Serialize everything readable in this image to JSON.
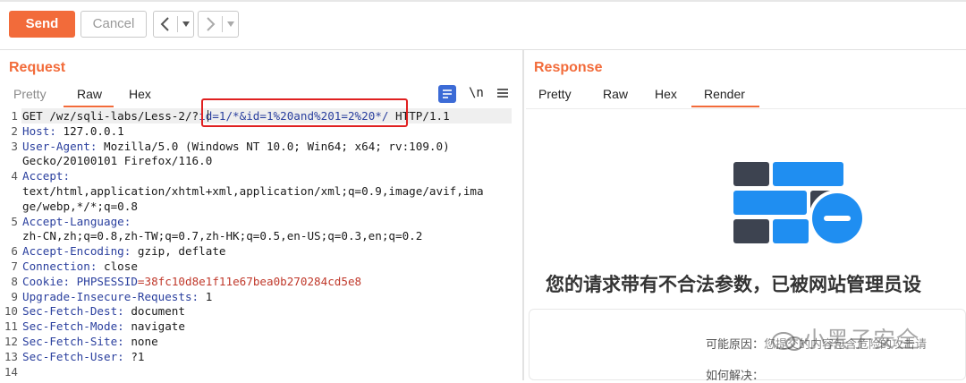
{
  "toolbar": {
    "send_label": "Send",
    "cancel_label": "Cancel",
    "back_icon": "chevron-left-icon",
    "forward_icon": "chevron-right-icon"
  },
  "request": {
    "title": "Request",
    "tabs": [
      "Pretty",
      "Raw",
      "Hex"
    ],
    "active_tab": "Raw",
    "toolbar_icons": [
      "message-format-icon",
      "newline-toggle-icon",
      "menu-icon"
    ],
    "newline_label": "\\n",
    "lines": [
      {
        "n": "1",
        "parts": [
          {
            "t": "GET /wz/sqli-labs/Less-2/?",
            "c": "plain"
          },
          {
            "t": "id=1/*&id=1%20and%201=2%20*/",
            "c": "param"
          },
          {
            "t": " HTTP/1.1",
            "c": "plain"
          }
        ]
      },
      {
        "n": "2",
        "parts": [
          {
            "t": "Host:",
            "c": "key"
          },
          {
            "t": " 127.0.0.1",
            "c": "plain"
          }
        ]
      },
      {
        "n": "3",
        "parts": [
          {
            "t": "User-Agent:",
            "c": "key"
          },
          {
            "t": " Mozilla/5.0 (Windows NT 10.0; Win64; x64; rv:109.0)",
            "c": "plain"
          }
        ]
      },
      {
        "n": "",
        "parts": [
          {
            "t": "Gecko/20100101 Firefox/116.0",
            "c": "plain"
          }
        ]
      },
      {
        "n": "4",
        "parts": [
          {
            "t": "Accept:",
            "c": "key"
          }
        ]
      },
      {
        "n": "",
        "parts": [
          {
            "t": "text/html,application/xhtml+xml,application/xml;q=0.9,image/avif,ima",
            "c": "plain"
          }
        ]
      },
      {
        "n": "",
        "parts": [
          {
            "t": "ge/webp,*/*;q=0.8",
            "c": "plain"
          }
        ]
      },
      {
        "n": "5",
        "parts": [
          {
            "t": "Accept-Language:",
            "c": "key"
          }
        ]
      },
      {
        "n": "",
        "parts": [
          {
            "t": "zh-CN,zh;q=0.8,zh-TW;q=0.7,zh-HK;q=0.5,en-US;q=0.3,en;q=0.2",
            "c": "plain"
          }
        ]
      },
      {
        "n": "6",
        "parts": [
          {
            "t": "Accept-Encoding:",
            "c": "key"
          },
          {
            "t": " gzip, deflate",
            "c": "plain"
          }
        ]
      },
      {
        "n": "7",
        "parts": [
          {
            "t": "Connection:",
            "c": "key"
          },
          {
            "t": " close",
            "c": "plain"
          }
        ]
      },
      {
        "n": "8",
        "parts": [
          {
            "t": "Cookie:",
            "c": "key"
          },
          {
            "t": " ",
            "c": "plain"
          },
          {
            "t": "PHPSESSID",
            "c": "key"
          },
          {
            "t": "=38fc10d8e1f11e67bea0b270284cd5e8",
            "c": "cookie"
          }
        ]
      },
      {
        "n": "9",
        "parts": [
          {
            "t": "Upgrade-Insecure-Requests:",
            "c": "key"
          },
          {
            "t": " 1",
            "c": "plain"
          }
        ]
      },
      {
        "n": "10",
        "parts": [
          {
            "t": "Sec-Fetch-Dest:",
            "c": "key"
          },
          {
            "t": " document",
            "c": "plain"
          }
        ]
      },
      {
        "n": "11",
        "parts": [
          {
            "t": "Sec-Fetch-Mode:",
            "c": "key"
          },
          {
            "t": " navigate",
            "c": "plain"
          }
        ]
      },
      {
        "n": "12",
        "parts": [
          {
            "t": "Sec-Fetch-Site:",
            "c": "key"
          },
          {
            "t": " none",
            "c": "plain"
          }
        ]
      },
      {
        "n": "13",
        "parts": [
          {
            "t": "Sec-Fetch-User:",
            "c": "key"
          },
          {
            "t": " ?1",
            "c": "plain"
          }
        ]
      },
      {
        "n": "14",
        "parts": []
      }
    ]
  },
  "response": {
    "title": "Response",
    "tabs": [
      "Pretty",
      "Raw",
      "Hex",
      "Render"
    ],
    "active_tab": "Render",
    "render": {
      "heading": "您的请求带有不合法参数，已被网站管理员设",
      "reason_label": "可能原因：",
      "reason_text": "您提交的内容包含危险的攻击请",
      "howto_label": "如何解决：",
      "watermark": "小黑子安全",
      "waf_icon": "firewall-blocked-icon"
    }
  },
  "colors": {
    "accent": "#f26b3a",
    "highlight_border": "#e02020",
    "header_key": "#2a3f9e",
    "cookie_value": "#c0392b"
  }
}
